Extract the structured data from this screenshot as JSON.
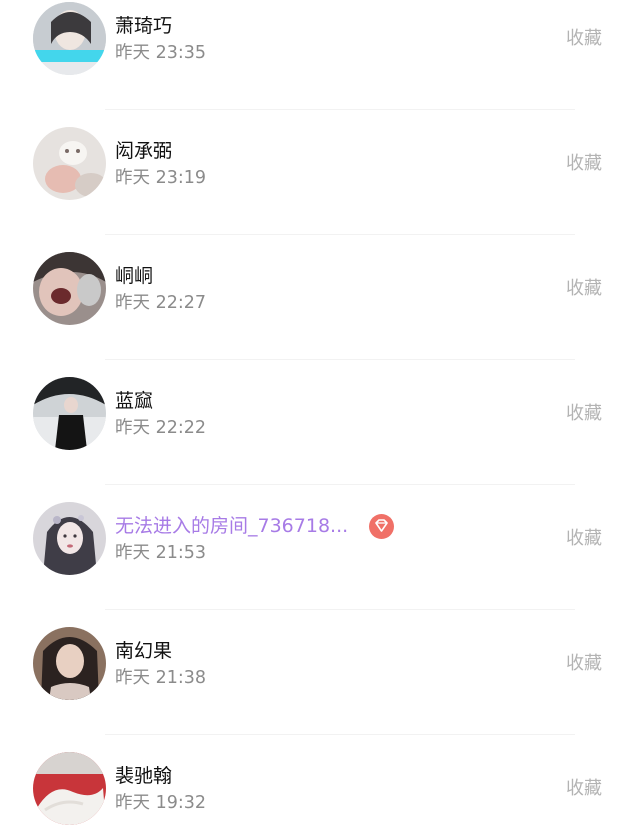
{
  "action_label": "收藏",
  "items": [
    {
      "name": "萧琦巧",
      "time": "昨天 23:35",
      "avatar": "avatar-1"
    },
    {
      "name": "闳承弼",
      "time": "昨天 23:19",
      "avatar": "avatar-2"
    },
    {
      "name": "峒峒",
      "time": "昨天 22:27",
      "avatar": "avatar-3"
    },
    {
      "name": "蓝窳",
      "time": "昨天 22:22",
      "avatar": "avatar-4"
    },
    {
      "name": "无法进入的房间_736718...",
      "time": "昨天 21:53",
      "avatar": "avatar-5",
      "badge": "diamond-icon",
      "name_color": "#a77be6"
    },
    {
      "name": "南幻果",
      "time": "昨天 21:38",
      "avatar": "avatar-6"
    },
    {
      "name": "裴驰翰",
      "time": "昨天 19:32",
      "avatar": "avatar-7"
    }
  ],
  "colors": {
    "name": "#111111",
    "time": "#8b8b8b",
    "action": "#b3b3b3",
    "highlight_name": "#a77be6",
    "badge": "#f07067"
  }
}
